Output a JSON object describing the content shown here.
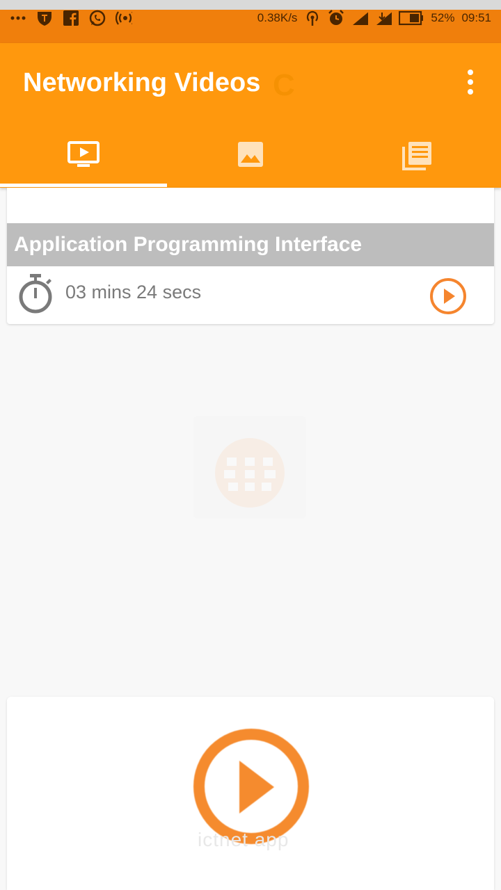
{
  "status_bar": {
    "net_speed": "0.38K/s",
    "battery_pct": "52%",
    "time": "09:51",
    "signal_label": "H",
    "icons": [
      "more-dots-icon",
      "shield-icon",
      "facebook-icon",
      "whatsapp-icon",
      "hotspot-icon",
      "wifi-hotspot-icon",
      "alarm-icon",
      "signal-icon",
      "signal-h-icon",
      "battery-icon"
    ]
  },
  "app_bar": {
    "title": "Networking Videos",
    "ghost_letter": "C",
    "overflow_icon": "more-vert-icon"
  },
  "tabs": [
    {
      "name": "videos",
      "icon": "video-tab-icon",
      "selected": true
    },
    {
      "name": "images",
      "icon": "image-tab-icon",
      "selected": false
    },
    {
      "name": "articles",
      "icon": "articles-tab-icon",
      "selected": false
    }
  ],
  "video_card": {
    "title": "Application Programming Interface",
    "duration": "03 mins 24 secs"
  },
  "bottom_card": {
    "faint_text": "ictnet app"
  },
  "colors": {
    "status_bar": "#f07f0c",
    "app_bar": "#ff980d",
    "accent": "#f5852e",
    "title_band": "#bdbdbd"
  }
}
